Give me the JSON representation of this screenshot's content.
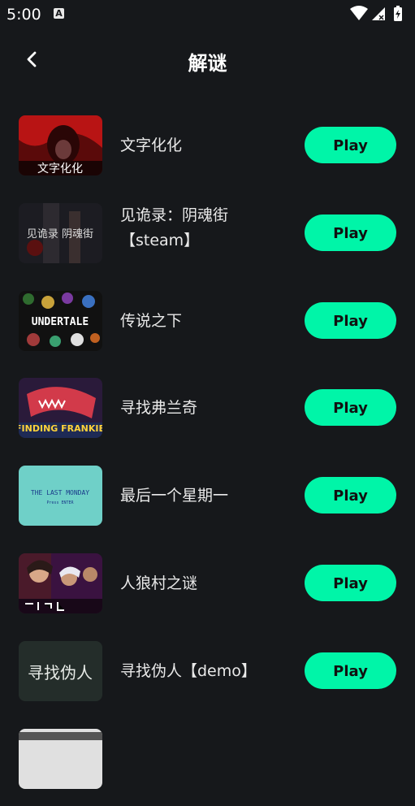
{
  "status_bar": {
    "time": "5:00",
    "notification_badge": "A",
    "icons": [
      "wifi-icon",
      "cellular-icon",
      "battery-charging-icon"
    ]
  },
  "header": {
    "title": "解谜",
    "back_icon": "chevron-left-icon"
  },
  "colors": {
    "background": "#16181b",
    "accent": "#00f5a8"
  },
  "games": [
    {
      "name": "文字化化",
      "button": "Play",
      "thumb_text": "文字化化"
    },
    {
      "name": "见诡录：阴魂街【steam】",
      "button": "Play",
      "thumb_text": "见诡录 阴魂街"
    },
    {
      "name": "传说之下",
      "button": "Play",
      "thumb_text": "UNDERTALE"
    },
    {
      "name": "寻找弗兰奇",
      "button": "Play",
      "thumb_text": "FINDING FRANKIE"
    },
    {
      "name": "最后一个星期一",
      "button": "Play",
      "thumb_text": "THE LAST MONDAY",
      "thumb_subtext": "Press ENTER"
    },
    {
      "name": "人狼村之谜",
      "button": "Play",
      "thumb_text": ""
    },
    {
      "name": "寻找伪人【demo】",
      "button": "Play",
      "thumb_text": "寻找伪人"
    }
  ]
}
